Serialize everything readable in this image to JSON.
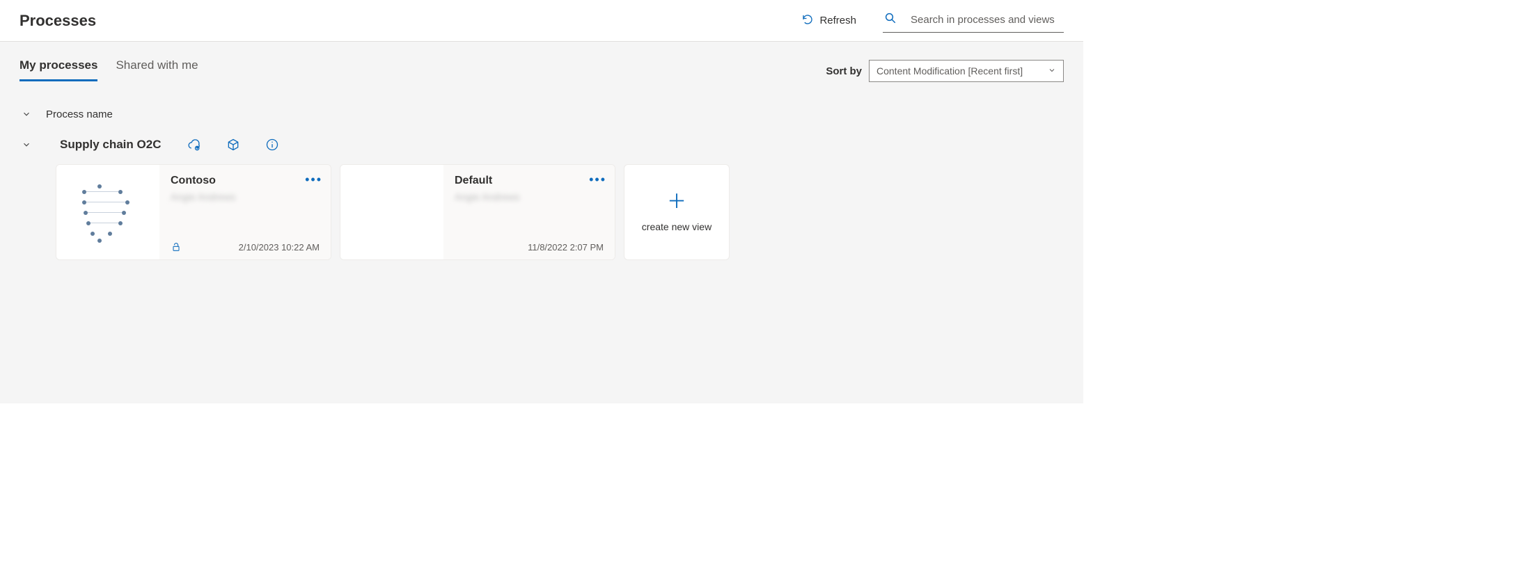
{
  "header": {
    "title": "Processes",
    "refresh_label": "Refresh",
    "search_placeholder": "Search in processes and views"
  },
  "tabs": {
    "my_processes": "My processes",
    "shared_with_me": "Shared with me"
  },
  "sort": {
    "label": "Sort by",
    "selected": "Content Modification [Recent first]"
  },
  "groups": {
    "process_name_header": "Process name",
    "supply_chain": {
      "name": "Supply chain O2C",
      "views": [
        {
          "title": "Contoso",
          "owner": "Angie Andrews",
          "timestamp": "2/10/2023 10:22 AM",
          "has_lock": true
        },
        {
          "title": "Default",
          "owner": "Angie Andrews",
          "timestamp": "11/8/2022 2:07 PM",
          "has_lock": false
        }
      ]
    }
  },
  "actions": {
    "create_new_view": "create new view"
  }
}
